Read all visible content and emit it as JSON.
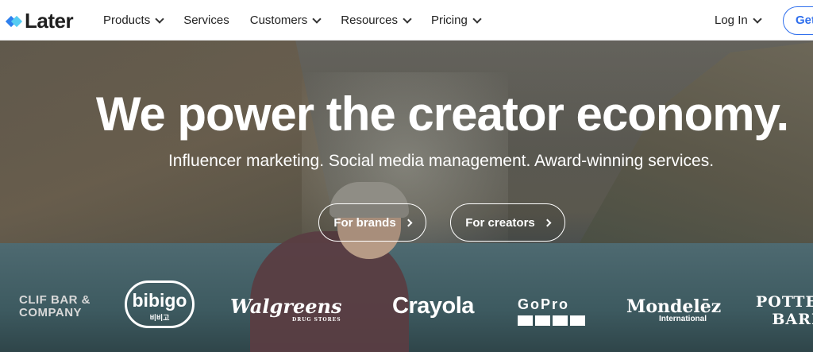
{
  "nav": {
    "brand": "Later",
    "items": [
      {
        "label": "Products",
        "has_dropdown": true
      },
      {
        "label": "Services",
        "has_dropdown": false
      },
      {
        "label": "Customers",
        "has_dropdown": true
      },
      {
        "label": "Resources",
        "has_dropdown": true
      },
      {
        "label": "Pricing",
        "has_dropdown": true
      }
    ],
    "login_label": "Log In",
    "cta_label": "Get"
  },
  "hero": {
    "headline": "We power the creator economy.",
    "subline": "Influencer marketing. Social media management. Award-winning services.",
    "buttons": {
      "brands": "For brands",
      "creators": "For creators"
    }
  },
  "logos": {
    "clif_line1": "CLIF BAR &",
    "clif_line2": "COMPANY",
    "bibigo": "bibigo",
    "bibigo_sub": "비비고",
    "walgreens": "Walgreens",
    "walgreens_sub": "DRUG STORES",
    "crayola": "Crayola",
    "gopro": "GoPro",
    "mondelez": "Mondelēz",
    "mondelez_sub": "International",
    "pottery_line1": "POTTERY",
    "pottery_line2": "BARN"
  },
  "colors": {
    "accent": "#2f6fed",
    "logo_blue": "#2f80ed",
    "logo_light": "#56ccf2",
    "nav_text": "#222222"
  },
  "icons": {
    "logo": "later-diamond-logo",
    "dropdown": "chevron-down-icon",
    "cta_arrow": "chevron-right-icon"
  }
}
